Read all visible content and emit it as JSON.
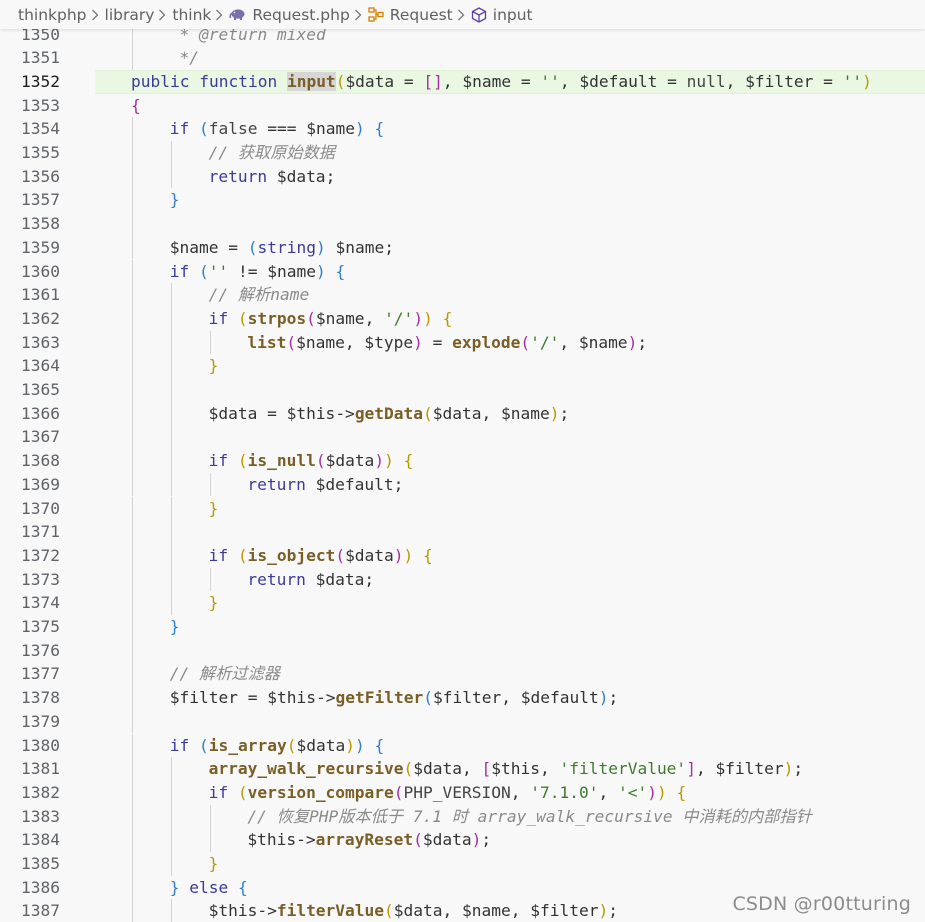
{
  "breadcrumb": {
    "items": [
      {
        "label": "thinkphp",
        "icon": ""
      },
      {
        "label": "library",
        "icon": ""
      },
      {
        "label": "think",
        "icon": ""
      },
      {
        "label": "Request.php",
        "icon": "php-elephant-icon"
      },
      {
        "label": "Request",
        "icon": "class-icon"
      },
      {
        "label": "input",
        "icon": "method-cube-icon"
      }
    ]
  },
  "editor": {
    "active_line": 1352,
    "lines": [
      {
        "n": 1350,
        "indent": 1,
        "tokens": [
          [
            "cmt",
            " * @return mixed"
          ]
        ]
      },
      {
        "n": 1351,
        "indent": 1,
        "tokens": [
          [
            "cmt",
            " */"
          ]
        ]
      },
      {
        "n": 1352,
        "indent": 0,
        "tokens": [
          [
            "kw",
            "public"
          ],
          [
            "op",
            " "
          ],
          [
            "kw",
            "function"
          ],
          [
            "op",
            " "
          ],
          [
            "fnhl",
            "input"
          ],
          [
            "b1",
            "("
          ],
          [
            "var",
            "$data"
          ],
          [
            "op",
            " = "
          ],
          [
            "b2",
            "["
          ],
          [
            "b2",
            "]"
          ],
          [
            "op",
            ", "
          ],
          [
            "var",
            "$name"
          ],
          [
            "op",
            " = "
          ],
          [
            "str",
            "''"
          ],
          [
            "op",
            ", "
          ],
          [
            "var",
            "$default"
          ],
          [
            "op",
            " = "
          ],
          [
            "const",
            "null"
          ],
          [
            "op",
            ", "
          ],
          [
            "var",
            "$filter"
          ],
          [
            "op",
            " = "
          ],
          [
            "str",
            "''"
          ],
          [
            "b1",
            ")"
          ]
        ]
      },
      {
        "n": 1353,
        "indent": 0,
        "tokens": [
          [
            "b2",
            "{"
          ]
        ]
      },
      {
        "n": 1354,
        "indent": 1,
        "tokens": [
          [
            "kw",
            "if"
          ],
          [
            "op",
            " "
          ],
          [
            "b3",
            "("
          ],
          [
            "const",
            "false"
          ],
          [
            "op",
            " === "
          ],
          [
            "var",
            "$name"
          ],
          [
            "b3",
            ")"
          ],
          [
            "op",
            " "
          ],
          [
            "b3",
            "{"
          ]
        ]
      },
      {
        "n": 1355,
        "indent": 2,
        "tokens": [
          [
            "cmt",
            "// 获取原始数据"
          ]
        ]
      },
      {
        "n": 1356,
        "indent": 2,
        "tokens": [
          [
            "kw",
            "return"
          ],
          [
            "op",
            " "
          ],
          [
            "var",
            "$data"
          ],
          [
            "op",
            ";"
          ]
        ]
      },
      {
        "n": 1357,
        "indent": 1,
        "tokens": [
          [
            "b3",
            "}"
          ]
        ]
      },
      {
        "n": 1358,
        "indent": 1,
        "tokens": []
      },
      {
        "n": 1359,
        "indent": 1,
        "tokens": [
          [
            "var",
            "$name"
          ],
          [
            "op",
            " = "
          ],
          [
            "b3",
            "("
          ],
          [
            "kw",
            "string"
          ],
          [
            "b3",
            ")"
          ],
          [
            "op",
            " "
          ],
          [
            "var",
            "$name"
          ],
          [
            "op",
            ";"
          ]
        ]
      },
      {
        "n": 1360,
        "indent": 1,
        "tokens": [
          [
            "kw",
            "if"
          ],
          [
            "op",
            " "
          ],
          [
            "b3",
            "("
          ],
          [
            "str",
            "''"
          ],
          [
            "op",
            " != "
          ],
          [
            "var",
            "$name"
          ],
          [
            "b3",
            ")"
          ],
          [
            "op",
            " "
          ],
          [
            "b3",
            "{"
          ]
        ]
      },
      {
        "n": 1361,
        "indent": 2,
        "tokens": [
          [
            "cmt",
            "// 解析name"
          ]
        ]
      },
      {
        "n": 1362,
        "indent": 2,
        "tokens": [
          [
            "kw",
            "if"
          ],
          [
            "op",
            " "
          ],
          [
            "b1",
            "("
          ],
          [
            "fn",
            "strpos"
          ],
          [
            "b2",
            "("
          ],
          [
            "var",
            "$name"
          ],
          [
            "op",
            ", "
          ],
          [
            "str",
            "'/'"
          ],
          [
            "b2",
            ")"
          ],
          [
            "b1",
            ")"
          ],
          [
            "op",
            " "
          ],
          [
            "b1",
            "{"
          ]
        ]
      },
      {
        "n": 1363,
        "indent": 3,
        "tokens": [
          [
            "fn",
            "list"
          ],
          [
            "b2",
            "("
          ],
          [
            "var",
            "$name"
          ],
          [
            "op",
            ", "
          ],
          [
            "var",
            "$type"
          ],
          [
            "b2",
            ")"
          ],
          [
            "op",
            " = "
          ],
          [
            "fn",
            "explode"
          ],
          [
            "b2",
            "("
          ],
          [
            "str",
            "'/'"
          ],
          [
            "op",
            ", "
          ],
          [
            "var",
            "$name"
          ],
          [
            "b2",
            ")"
          ],
          [
            "op",
            ";"
          ]
        ]
      },
      {
        "n": 1364,
        "indent": 2,
        "tokens": [
          [
            "b1",
            "}"
          ]
        ]
      },
      {
        "n": 1365,
        "indent": 2,
        "tokens": []
      },
      {
        "n": 1366,
        "indent": 2,
        "tokens": [
          [
            "var",
            "$data"
          ],
          [
            "op",
            " = "
          ],
          [
            "var",
            "$this"
          ],
          [
            "op",
            "->"
          ],
          [
            "fn",
            "getData"
          ],
          [
            "b1",
            "("
          ],
          [
            "var",
            "$data"
          ],
          [
            "op",
            ", "
          ],
          [
            "var",
            "$name"
          ],
          [
            "b1",
            ")"
          ],
          [
            "op",
            ";"
          ]
        ]
      },
      {
        "n": 1367,
        "indent": 2,
        "tokens": []
      },
      {
        "n": 1368,
        "indent": 2,
        "tokens": [
          [
            "kw",
            "if"
          ],
          [
            "op",
            " "
          ],
          [
            "b1",
            "("
          ],
          [
            "fn",
            "is_null"
          ],
          [
            "b2",
            "("
          ],
          [
            "var",
            "$data"
          ],
          [
            "b2",
            ")"
          ],
          [
            "b1",
            ")"
          ],
          [
            "op",
            " "
          ],
          [
            "b1",
            "{"
          ]
        ]
      },
      {
        "n": 1369,
        "indent": 3,
        "tokens": [
          [
            "kw",
            "return"
          ],
          [
            "op",
            " "
          ],
          [
            "var",
            "$default"
          ],
          [
            "op",
            ";"
          ]
        ]
      },
      {
        "n": 1370,
        "indent": 2,
        "tokens": [
          [
            "b1",
            "}"
          ]
        ]
      },
      {
        "n": 1371,
        "indent": 2,
        "tokens": []
      },
      {
        "n": 1372,
        "indent": 2,
        "tokens": [
          [
            "kw",
            "if"
          ],
          [
            "op",
            " "
          ],
          [
            "b1",
            "("
          ],
          [
            "fn",
            "is_object"
          ],
          [
            "b2",
            "("
          ],
          [
            "var",
            "$data"
          ],
          [
            "b2",
            ")"
          ],
          [
            "b1",
            ")"
          ],
          [
            "op",
            " "
          ],
          [
            "b1",
            "{"
          ]
        ]
      },
      {
        "n": 1373,
        "indent": 3,
        "tokens": [
          [
            "kw",
            "return"
          ],
          [
            "op",
            " "
          ],
          [
            "var",
            "$data"
          ],
          [
            "op",
            ";"
          ]
        ]
      },
      {
        "n": 1374,
        "indent": 2,
        "tokens": [
          [
            "b1",
            "}"
          ]
        ]
      },
      {
        "n": 1375,
        "indent": 1,
        "tokens": [
          [
            "b3",
            "}"
          ]
        ]
      },
      {
        "n": 1376,
        "indent": 1,
        "tokens": []
      },
      {
        "n": 1377,
        "indent": 1,
        "tokens": [
          [
            "cmt",
            "// 解析过滤器"
          ]
        ]
      },
      {
        "n": 1378,
        "indent": 1,
        "tokens": [
          [
            "var",
            "$filter"
          ],
          [
            "op",
            " = "
          ],
          [
            "var",
            "$this"
          ],
          [
            "op",
            "->"
          ],
          [
            "fn",
            "getFilter"
          ],
          [
            "b3",
            "("
          ],
          [
            "var",
            "$filter"
          ],
          [
            "op",
            ", "
          ],
          [
            "var",
            "$default"
          ],
          [
            "b3",
            ")"
          ],
          [
            "op",
            ";"
          ]
        ]
      },
      {
        "n": 1379,
        "indent": 1,
        "tokens": []
      },
      {
        "n": 1380,
        "indent": 1,
        "tokens": [
          [
            "kw",
            "if"
          ],
          [
            "op",
            " "
          ],
          [
            "b3",
            "("
          ],
          [
            "fn",
            "is_array"
          ],
          [
            "b1",
            "("
          ],
          [
            "var",
            "$data"
          ],
          [
            "b1",
            ")"
          ],
          [
            "b3",
            ")"
          ],
          [
            "op",
            " "
          ],
          [
            "b3",
            "{"
          ]
        ]
      },
      {
        "n": 1381,
        "indent": 2,
        "tokens": [
          [
            "fn",
            "array_walk_recursive"
          ],
          [
            "b1",
            "("
          ],
          [
            "var",
            "$data"
          ],
          [
            "op",
            ", "
          ],
          [
            "b2",
            "["
          ],
          [
            "var",
            "$this"
          ],
          [
            "op",
            ", "
          ],
          [
            "str",
            "'filterValue'"
          ],
          [
            "b2",
            "]"
          ],
          [
            "op",
            ", "
          ],
          [
            "var",
            "$filter"
          ],
          [
            "b1",
            ")"
          ],
          [
            "op",
            ";"
          ]
        ]
      },
      {
        "n": 1382,
        "indent": 2,
        "tokens": [
          [
            "kw",
            "if"
          ],
          [
            "op",
            " "
          ],
          [
            "b1",
            "("
          ],
          [
            "fn",
            "version_compare"
          ],
          [
            "b2",
            "("
          ],
          [
            "const",
            "PHP_VERSION"
          ],
          [
            "op",
            ", "
          ],
          [
            "str",
            "'7.1.0'"
          ],
          [
            "op",
            ", "
          ],
          [
            "str",
            "'<'"
          ],
          [
            "b2",
            ")"
          ],
          [
            "b1",
            ")"
          ],
          [
            "op",
            " "
          ],
          [
            "b1",
            "{"
          ]
        ]
      },
      {
        "n": 1383,
        "indent": 3,
        "tokens": [
          [
            "cmt",
            "// 恢复PHP版本低于 7.1 时 array_walk_recursive 中消耗的内部指针"
          ]
        ]
      },
      {
        "n": 1384,
        "indent": 3,
        "tokens": [
          [
            "var",
            "$this"
          ],
          [
            "op",
            "->"
          ],
          [
            "fn",
            "arrayReset"
          ],
          [
            "b2",
            "("
          ],
          [
            "var",
            "$data"
          ],
          [
            "b2",
            ")"
          ],
          [
            "op",
            ";"
          ]
        ]
      },
      {
        "n": 1385,
        "indent": 2,
        "tokens": [
          [
            "b1",
            "}"
          ]
        ]
      },
      {
        "n": 1386,
        "indent": 1,
        "tokens": [
          [
            "b3",
            "}"
          ],
          [
            "op",
            " "
          ],
          [
            "kw",
            "else"
          ],
          [
            "op",
            " "
          ],
          [
            "b3",
            "{"
          ]
        ]
      },
      {
        "n": 1387,
        "indent": 2,
        "tokens": [
          [
            "var",
            "$this"
          ],
          [
            "op",
            "->"
          ],
          [
            "fn",
            "filterValue"
          ],
          [
            "b1",
            "("
          ],
          [
            "var",
            "$data"
          ],
          [
            "op",
            ", "
          ],
          [
            "var",
            "$name"
          ],
          [
            "op",
            ", "
          ],
          [
            "var",
            "$filter"
          ],
          [
            "b1",
            ")"
          ],
          [
            "op",
            ";"
          ]
        ]
      }
    ]
  },
  "watermark": "CSDN @r00tturing"
}
